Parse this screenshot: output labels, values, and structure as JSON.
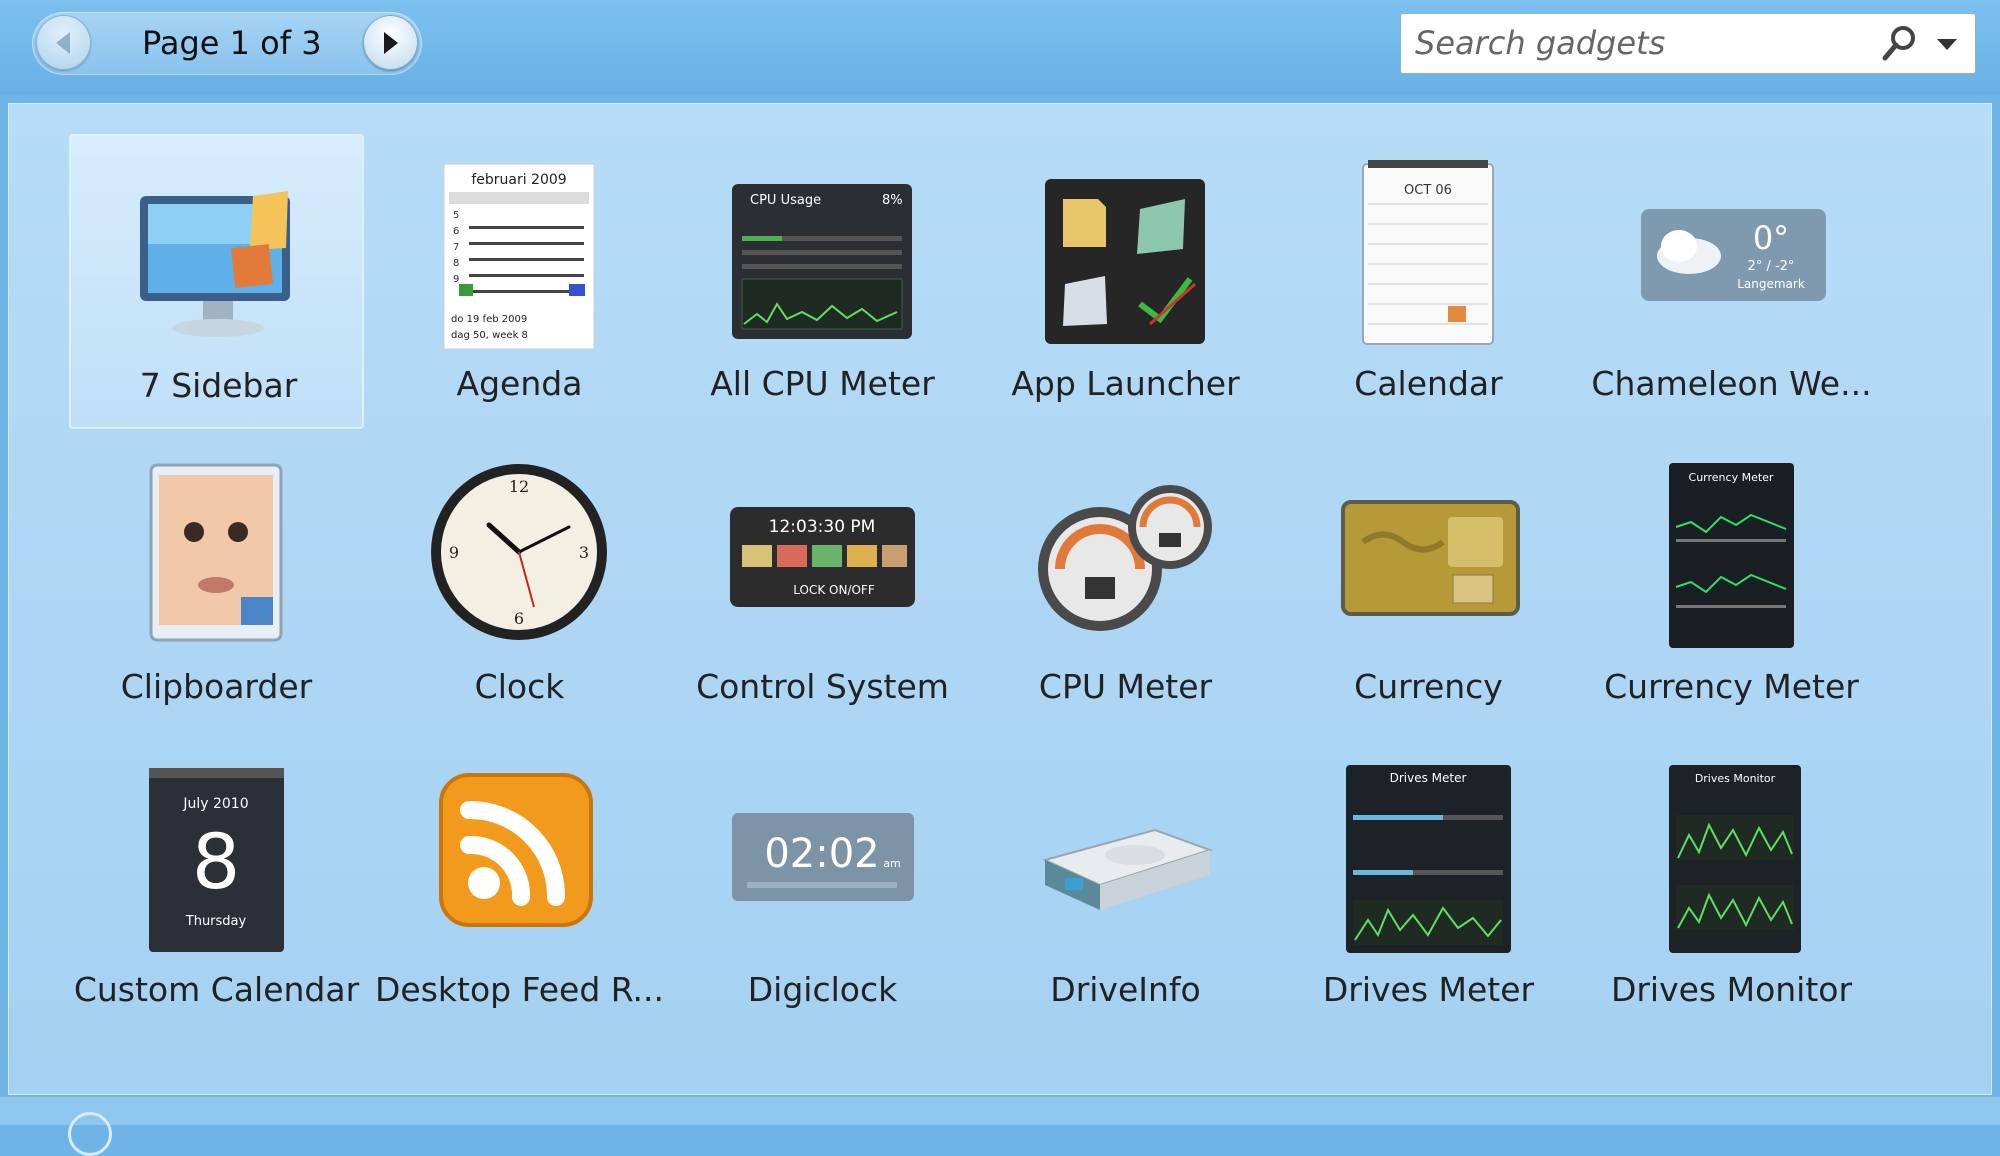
{
  "pager": {
    "label": "Page 1 of 3"
  },
  "search": {
    "placeholder": "Search gadgets",
    "value": ""
  },
  "gadgets": [
    {
      "label": "7 Sidebar",
      "icon": "monitor-sidebar-icon",
      "selected": true
    },
    {
      "label": "Agenda",
      "icon": "agenda-calendar-icon",
      "detail": {
        "month": "februari 2009",
        "footer1": "do 19 feb 2009",
        "footer2": "dag 50, week 8"
      }
    },
    {
      "label": "All CPU Meter",
      "icon": "cpu-usage-icon",
      "detail": {
        "title": "CPU Usage",
        "value": "8%"
      }
    },
    {
      "label": "App Launcher",
      "icon": "app-launcher-icon"
    },
    {
      "label": "Calendar",
      "icon": "calendar-icon",
      "detail": {
        "month": "OCT 06"
      }
    },
    {
      "label": "Chameleon We...",
      "icon": "weather-icon",
      "detail": {
        "temp": "0°",
        "range": "2° / -2°",
        "place": "Langemark"
      }
    },
    {
      "label": "Clipboarder",
      "icon": "clipboarder-icon"
    },
    {
      "label": "Clock",
      "icon": "analog-clock-icon"
    },
    {
      "label": "Control System",
      "icon": "control-system-icon",
      "detail": {
        "time": "12:03:30 PM",
        "lock": "LOCK ON/OFF"
      }
    },
    {
      "label": "CPU Meter",
      "icon": "cpu-meter-gauge-icon"
    },
    {
      "label": "Currency",
      "icon": "currency-card-icon"
    },
    {
      "label": "Currency Meter",
      "icon": "currency-meter-icon",
      "detail": {
        "title": "Currency Meter"
      }
    },
    {
      "label": "Custom Calendar",
      "icon": "custom-calendar-icon",
      "detail": {
        "month": "July 2010",
        "day": "8",
        "weekday": "Thursday"
      }
    },
    {
      "label": "Desktop Feed R...",
      "icon": "rss-feed-icon"
    },
    {
      "label": "Digiclock",
      "icon": "digital-clock-icon",
      "detail": {
        "time": "02:02",
        "ampm": "am"
      }
    },
    {
      "label": "DriveInfo",
      "icon": "hard-drive-icon"
    },
    {
      "label": "Drives Meter",
      "icon": "drives-meter-icon",
      "detail": {
        "title": "Drives Meter"
      }
    },
    {
      "label": "Drives Monitor",
      "icon": "drives-monitor-icon",
      "detail": {
        "title": "Drives Monitor"
      }
    }
  ]
}
